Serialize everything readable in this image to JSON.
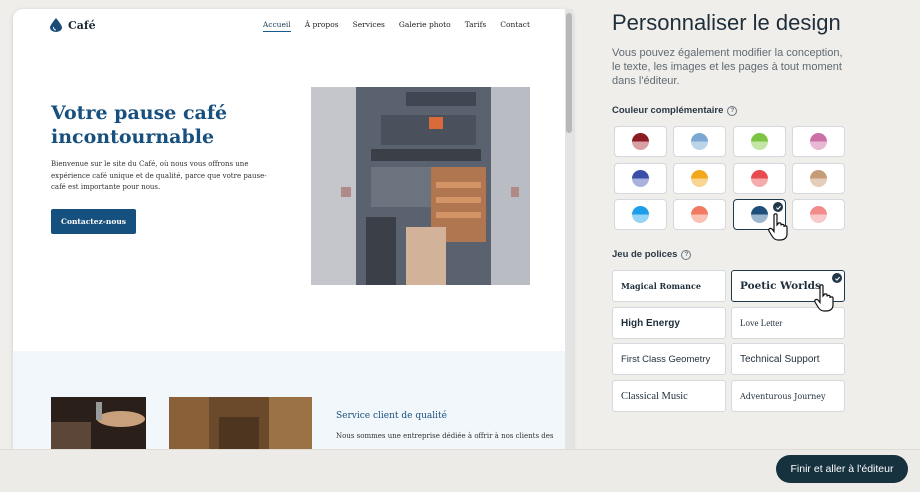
{
  "preview": {
    "logo_text": "Café",
    "nav": [
      "Accueil",
      "À propos",
      "Services",
      "Galerie photo",
      "Tarifs",
      "Contact"
    ],
    "hero_title": "Votre pause café incontournable",
    "hero_text": "Bienvenue sur le site du Café, où nous vous offrons une expérience café unique et de qualité, parce que votre pause-café est importante pour nous.",
    "cta_label": "Contactez-nous",
    "section2_title": "Service client de qualité",
    "section2_text": "Nous sommes une entreprise dédiée à offrir à nos clients des"
  },
  "panel": {
    "title": "Personnaliser le design",
    "description": "Vous pouvez également modifier la conception, le texte, les images et les pages à tout moment dans l'éditeur.",
    "color_label": "Couleur complémentaire",
    "font_label": "Jeu de polices",
    "colors": [
      {
        "top": "#8b1c25",
        "bottom": "#d9a0a4"
      },
      {
        "top": "#7aa8d2",
        "bottom": "#bcd4ea"
      },
      {
        "top": "#7cc441",
        "bottom": "#c3e5a5"
      },
      {
        "top": "#cc6fa6",
        "bottom": "#e8b8d4"
      },
      {
        "top": "#3a4ea8",
        "bottom": "#a9b2dc"
      },
      {
        "top": "#f2a81d",
        "bottom": "#f8d592"
      },
      {
        "top": "#e84a4f",
        "bottom": "#f6abad"
      },
      {
        "top": "#c69b78",
        "bottom": "#e4cdb9"
      },
      {
        "top": "#1c9ee8",
        "bottom": "#94d4f6"
      },
      {
        "top": "#f27a60",
        "bottom": "#f9c2b4"
      },
      {
        "top": "#1e4f7c",
        "bottom": "#9cb6d0"
      },
      {
        "top": "#f28b8c",
        "bottom": "#f9c9c9"
      }
    ],
    "selected_color": 10,
    "fonts": [
      "Magical Romance",
      "Poetic Worlds",
      "High Energy",
      "Love Letter",
      "First Class Geometry",
      "Technical Support",
      "Classical Music",
      "Adventurous Journey"
    ],
    "selected_font": 1
  },
  "footer": {
    "finish_label": "Finir et aller à l'éditeur"
  }
}
